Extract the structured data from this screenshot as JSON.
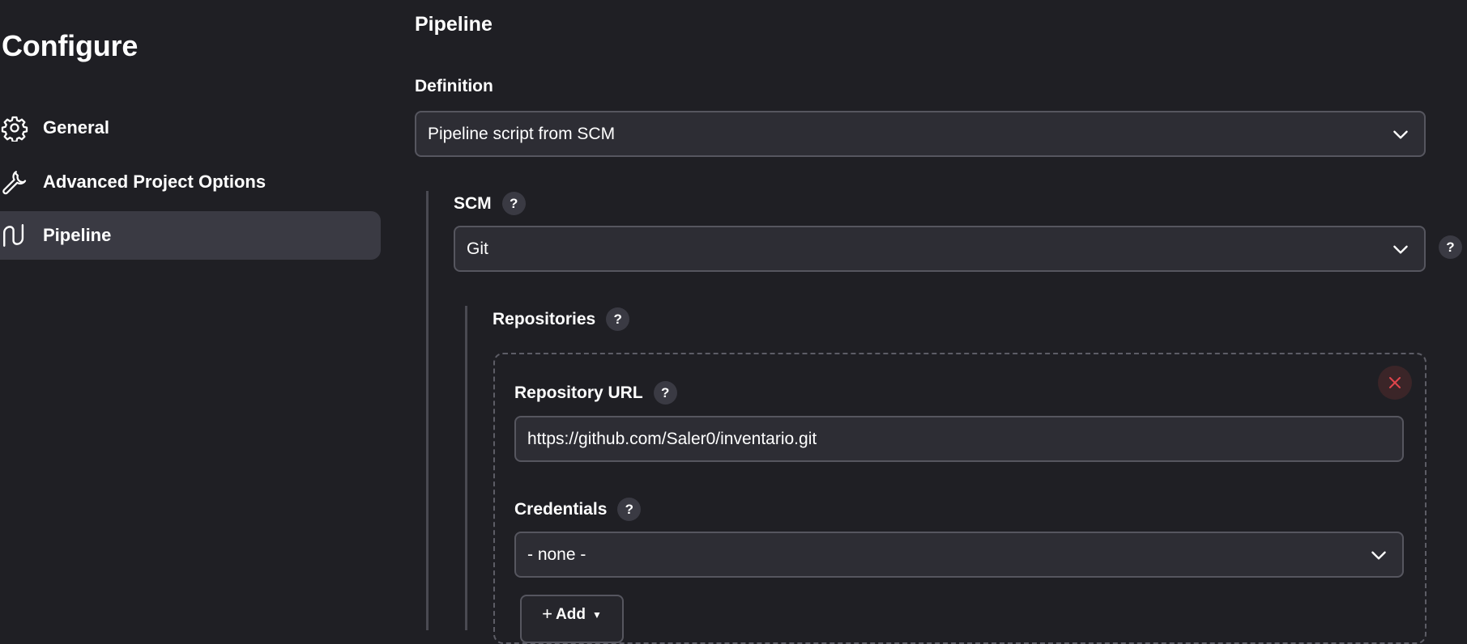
{
  "sidebar": {
    "title": "Configure",
    "items": [
      {
        "label": "General",
        "icon": "gear-icon",
        "active": false
      },
      {
        "label": "Advanced Project Options",
        "icon": "wrench-icon",
        "active": false
      },
      {
        "label": "Pipeline",
        "icon": "pipeline-icon",
        "active": true
      }
    ]
  },
  "main": {
    "section_title": "Pipeline",
    "definition": {
      "label": "Definition",
      "selected": "Pipeline script from SCM"
    },
    "scm": {
      "label": "SCM",
      "help": "?",
      "selected": "Git",
      "outer_help": "?"
    },
    "repositories": {
      "label": "Repositories",
      "help": "?",
      "repo_url": {
        "label": "Repository URL",
        "help": "?",
        "value": "https://github.com/Saler0/inventario.git"
      },
      "credentials": {
        "label": "Credentials",
        "help": "?",
        "selected": "- none -"
      },
      "add_button": {
        "plus": "+",
        "label": "Add"
      }
    }
  },
  "colors": {
    "background": "#1f1f24",
    "active_nav": "#3a3a43",
    "input_bg": "#2d2d34",
    "input_border": "#56565f",
    "delete_accent": "#e0454b"
  }
}
